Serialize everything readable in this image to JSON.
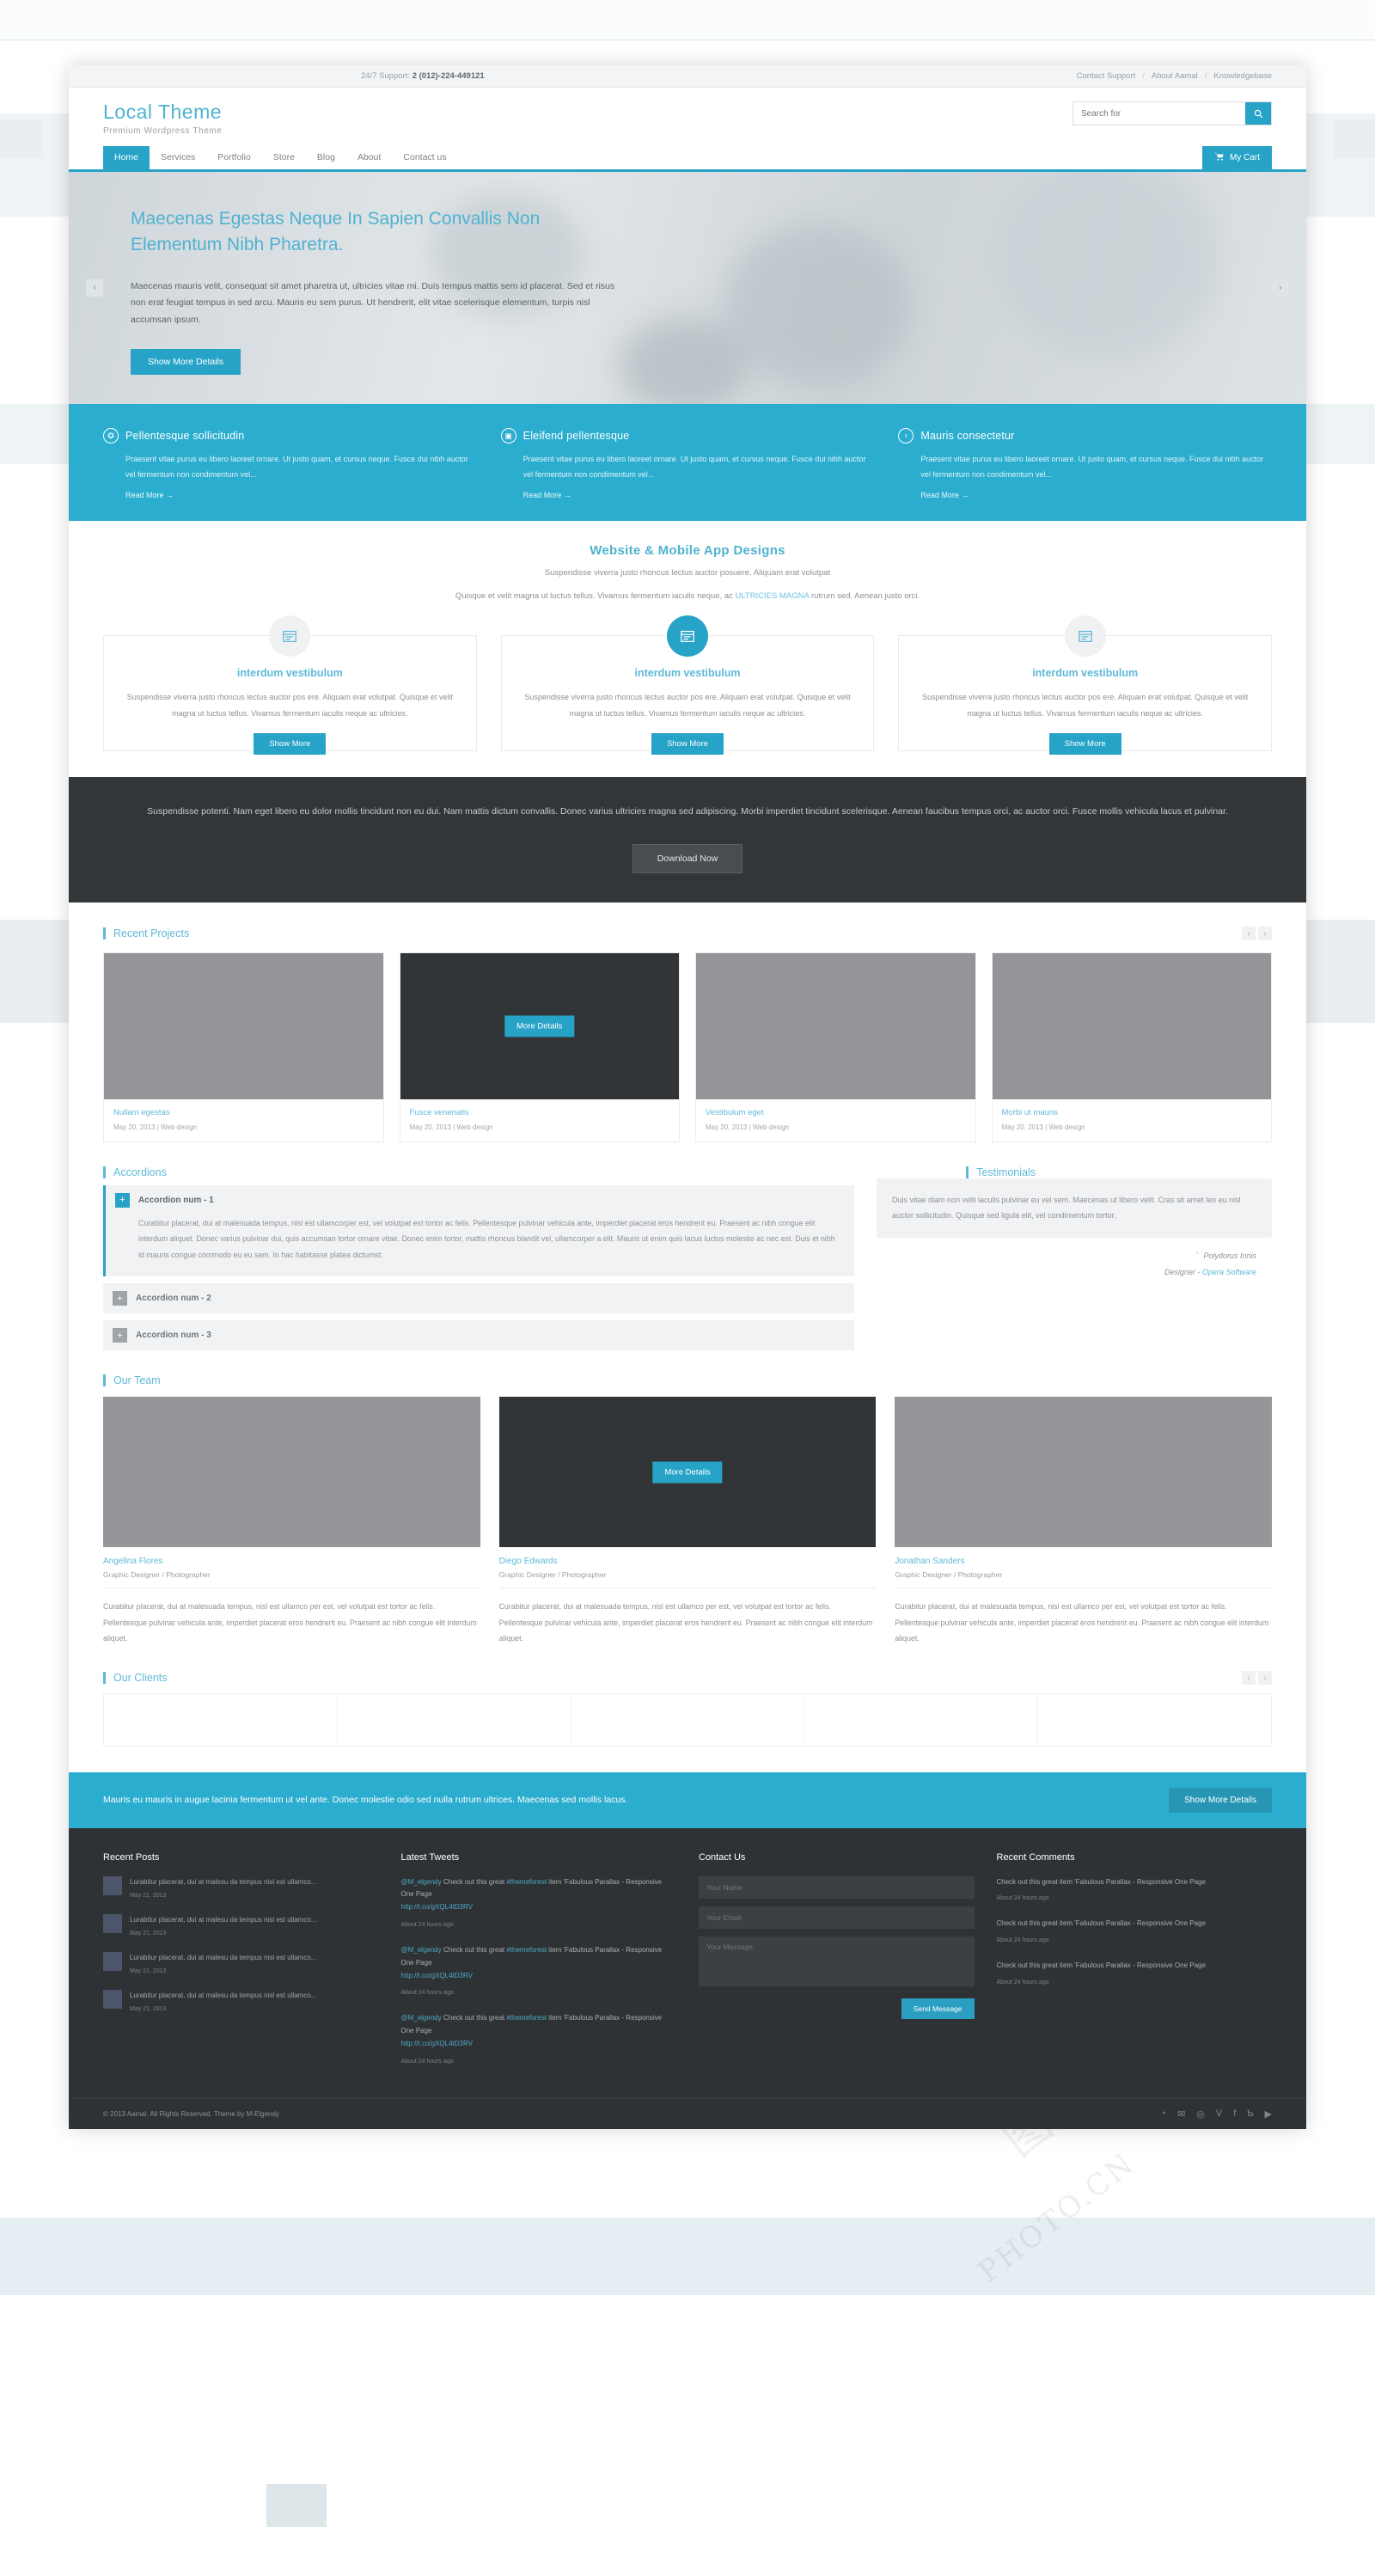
{
  "topbar": {
    "support_label": "24/7 Support:",
    "support_phone": "2 (012)-224-449121",
    "links": [
      "Contact Support",
      "About Aamal",
      "Knowledgebase"
    ],
    "separator": "/"
  },
  "header": {
    "brand": "Local Theme",
    "tagline": "Premium Wordpress Theme",
    "search_placeholder": "Search for",
    "search_value": "",
    "search_icon": "search-icon",
    "cart_label": "My Cart",
    "cart_icon": "cart-icon"
  },
  "nav": {
    "items": [
      "Home",
      "Services",
      "Portfolio",
      "Store",
      "Blog",
      "About",
      "Contact us"
    ],
    "active": "Home"
  },
  "hero": {
    "title": "Maecenas Egestas Neque In Sapien Convallis Non Elementum Nibh Pharetra.",
    "body": "Maecenas mauris velit, consequat sit amet pharetra ut, ultricies vitae mi. Duis tempus mattis sem id placerat. Sed et risus non erat feugiat tempus in sed arcu. Mauris eu sem purus. Ut hendrerit, elit vitae scelerisque elementum, turpis nisl accumsan ipsum.",
    "cta": "Show More Details",
    "prev_icon": "chevron-left-icon",
    "next_icon": "chevron-right-icon",
    "prev": "‹",
    "next": "›"
  },
  "features": [
    {
      "icon": "bicycle-icon",
      "glyph": "✪",
      "title": "Pellentesque sollicitudin",
      "body": "Praesent vitae purus eu libero laoreet ornare. Ut justo quam, et cursus neque. Fusce dui nibh auctor vel fermentum non condimentum vel...",
      "more": "Read More →"
    },
    {
      "icon": "camera-icon",
      "glyph": "▣",
      "title": "Eleifend pellentesque",
      "body": "Praesent vitae purus eu libero laoreet ornare. Ut justo quam, et cursus neque. Fusce dui nibh auctor vel fermentum non condimentum vel...",
      "more": "Read More →"
    },
    {
      "icon": "person-icon",
      "glyph": "♀",
      "title": "Mauris consectetur",
      "body": "Praesent vitae purus eu libero laoreet ornare. Ut justo quam, et cursus neque. Fusce dui nibh auctor vel fermentum non condimentum vel...",
      "more": "Read More →"
    }
  ],
  "services_intro": {
    "title": "Website & Mobile App Designs",
    "line1": "Suspendisse viverra justo rhoncus lectus auctor posuere. Aliquam erat volutpat",
    "line2_a": "Quisque et velit magna ut luctus tellus. Vivamus fermentum iaculis neque, ac ",
    "line2_link": "ULTRICIES MAGNA",
    "line2_b": " rutrum sed. Aenean justo orci."
  },
  "services": [
    {
      "icon": "window-icon",
      "title": "interdum vestibulum",
      "body": "Suspendisse viverra justo rhoncus lectus auctor pos ere. Aliquam erat volutpat. Quisque et velit magna ut luctus tellus. Vivamus fermentum iaculis neque ac ultricies.",
      "button": "Show More",
      "active": false
    },
    {
      "icon": "window-icon",
      "title": "interdum vestibulum",
      "body": "Suspendisse viverra justo rhoncus lectus auctor pos ere. Aliquam erat volutpat. Quisque et velit magna ut luctus tellus. Vivamus fermentum iaculis neque ac ultricies.",
      "button": "Show More",
      "active": true
    },
    {
      "icon": "window-icon",
      "title": "interdum vestibulum",
      "body": "Suspendisse viverra justo rhoncus lectus auctor pos ere. Aliquam erat volutpat. Quisque et velit magna ut luctus tellus. Vivamus fermentum iaculis neque ac ultricies.",
      "button": "Show More",
      "active": false
    }
  ],
  "cta_band": {
    "text": "Suspendisse potenti. Nam eget libero eu dolor mollis tincidunt non eu dui. Nam mattis dictum convallis. Donec varius ultricies magna sed adipiscing. Morbi imperdiet tincidunt scelerisque. Aenean faucibus tempus orci, ac auctor orci. Fusce mollis vehicula lacus et pulvinar.",
    "button": "Download Now"
  },
  "projects_section": {
    "title": "Recent Projects",
    "prev": "‹",
    "next": "›",
    "hover_button": "More Details",
    "items": [
      {
        "title": "Nullam egestas",
        "meta": "May 20, 2013 | Web design",
        "dark": false
      },
      {
        "title": "Fusce venenatis",
        "meta": "May 20, 2013 | Web design",
        "dark": true
      },
      {
        "title": "Vestibulum eget",
        "meta": "May 20, 2013 | Web design",
        "dark": false
      },
      {
        "title": "Morbi ut mauris",
        "meta": "May 20, 2013 | Web design",
        "dark": false
      }
    ]
  },
  "accordions_section": {
    "title": "Accordions",
    "items": [
      {
        "label": "Accordion num - 1",
        "open": true,
        "body": "Curabitur placerat, dui at malesuada tempus, nisl est ullamcorper est, vel volutpat est tortor ac felis. Pellentesque pulvinar vehicula ante, imperdiet placerat eros hendrerit eu. Praesent ac nibh congue elit interdum aliquet. Donec varius pulvinar dui, quis accumsan tortor ornare vitae. Donec enim tortor, mattis rhoncus blandit vel, ullamcorper a elit. Mauris ut enim quis lacus luctus molestie ac nec est. Duis et nibh id mauris congue commodo eu eu sem. In hac habitasse platea dictumst."
      },
      {
        "label": "Accordion num - 2",
        "open": false,
        "body": ""
      },
      {
        "label": "Accordion num - 3",
        "open": false,
        "body": ""
      }
    ]
  },
  "testimonials_section": {
    "title": "Testimonials",
    "quote": "Duis vitae diam non velit iaculis pulvinar eu vel sem. Maecenas ut libero velit. Cras sit amet leo eu nisl auctor sollicitudin. Quisque sed ligula elit, vel condimentum tortor.",
    "author": "Polydorus Innis",
    "role_prefix": "Designer - ",
    "company": "Opera Software",
    "quote_mark": "”"
  },
  "team_section": {
    "title": "Our Team",
    "hover_button": "More Details",
    "members": [
      {
        "name": "Angelina Flores",
        "role": "Graphic Designer / Photographer",
        "dark": false,
        "bio": "Curabitur placerat, dui at malesuada tempus, nisl est ullamco per est, vel volutpat est tortor ac felis. Pellentesque pulvinar vehicula ante, imperdiet placerat eros hendrerit eu. Praesent ac nibh congue elit interdum aliquet."
      },
      {
        "name": "Diego Edwards",
        "role": "Graphic Designer / Photographer",
        "dark": true,
        "bio": "Curabitur placerat, dui at malesuada tempus, nisl est ullamco per est, vel volutpat est tortor ac felis. Pellentesque pulvinar vehicula ante, imperdiet placerat eros hendrerit eu. Praesent ac nibh congue elit interdum aliquet."
      },
      {
        "name": "Jonathan Sanders",
        "role": "Graphic Designer / Photographer",
        "dark": false,
        "bio": "Curabitur placerat, dui at malesuada tempus, nisl est ullamco per est, vel volutpat est tortor ac felis. Pellentesque pulvinar vehicula ante, imperdiet placerat eros hendrerit eu. Praesent ac nibh congue elit interdum aliquet."
      }
    ]
  },
  "clients_section": {
    "title": "Our Clients",
    "prev": "‹",
    "next": "›",
    "slots": 5
  },
  "strip": {
    "text": "Mauris eu mauris in augue lacinia fermentum ut vel ante. Donec molestie odio sed nulla rutrum ultrices. Maecenas sed mollis lacus.",
    "button": "Show More Details"
  },
  "footer": {
    "recent_posts": {
      "title": "Recent Posts",
      "items": [
        {
          "text": "Lurabitur placerat, dui at malesu da tempus nisl est ullamco...",
          "date": "May 21, 2013"
        },
        {
          "text": "Lurabitur placerat, dui at malesu da tempus nisl est ullamco...",
          "date": "May 21, 2013"
        },
        {
          "text": "Lurabitur placerat, dui at malesu da tempus nisl est ullamco...",
          "date": "May 21, 2013"
        },
        {
          "text": "Lurabitur placerat, dui at malesu da tempus nisl est ullamco...",
          "date": "May 21, 2013"
        }
      ]
    },
    "latest_tweets": {
      "title": "Latest Tweets",
      "items": [
        {
          "handle": "@M_elgendy",
          "mid": " Check out this great ",
          "tag": "#themeforest",
          "rest": " item 'Fabulous Parallax - Responsive One Page",
          "link": "http://t.co/gXQL4tD3RV",
          "time": "About 24 hours ago"
        },
        {
          "handle": "@M_elgendy",
          "mid": " Check out this great ",
          "tag": "#themeforest",
          "rest": " item 'Fabulous Parallax - Responsive One Page",
          "link": "http://t.co/gXQL4tD3RV",
          "time": "About 24 hours ago"
        },
        {
          "handle": "@M_elgendy",
          "mid": " Check out this great ",
          "tag": "#themeforest",
          "rest": " item 'Fabulous Parallax - Responsive One Page",
          "link": "http://t.co/gXQL4tD3RV",
          "time": "About 24 hours ago"
        }
      ]
    },
    "contact": {
      "title": "Contact Us",
      "name_placeholder": "Your Name",
      "email_placeholder": "Your Email",
      "message_placeholder": "Your Message",
      "send_label": "Send Message"
    },
    "recent_comments": {
      "title": "Recent Comments",
      "items": [
        {
          "text": "Check out this great item 'Fabulous Parallax - Responsive One Page",
          "time": "About 24 hours ago"
        },
        {
          "text": "Check out this great item 'Fabulous Parallax - Responsive One Page",
          "time": "About 24 hours ago"
        },
        {
          "text": "Check out this great item 'Fabulous Parallax - Responsive One Page",
          "time": "About 24 hours ago"
        }
      ]
    },
    "copyright": "© 2013 Aamal. All Rights Reserved. Theme by M-Elgendy",
    "social": [
      {
        "name": "rss-icon",
        "glyph": "◔"
      },
      {
        "name": "twitter-icon",
        "glyph": "✉"
      },
      {
        "name": "dribbble-icon",
        "glyph": "◎"
      },
      {
        "name": "vimeo-icon",
        "glyph": "V"
      },
      {
        "name": "facebook-icon",
        "glyph": "f"
      },
      {
        "name": "behance-icon",
        "glyph": "Ƅ"
      },
      {
        "name": "youtube-icon",
        "glyph": "▶"
      }
    ]
  },
  "colors": {
    "accent": "#27a3c7",
    "accent_light": "#5fb9d6",
    "teal_band": "#2badcf",
    "dark": "#333638",
    "footer": "#2f3234"
  }
}
